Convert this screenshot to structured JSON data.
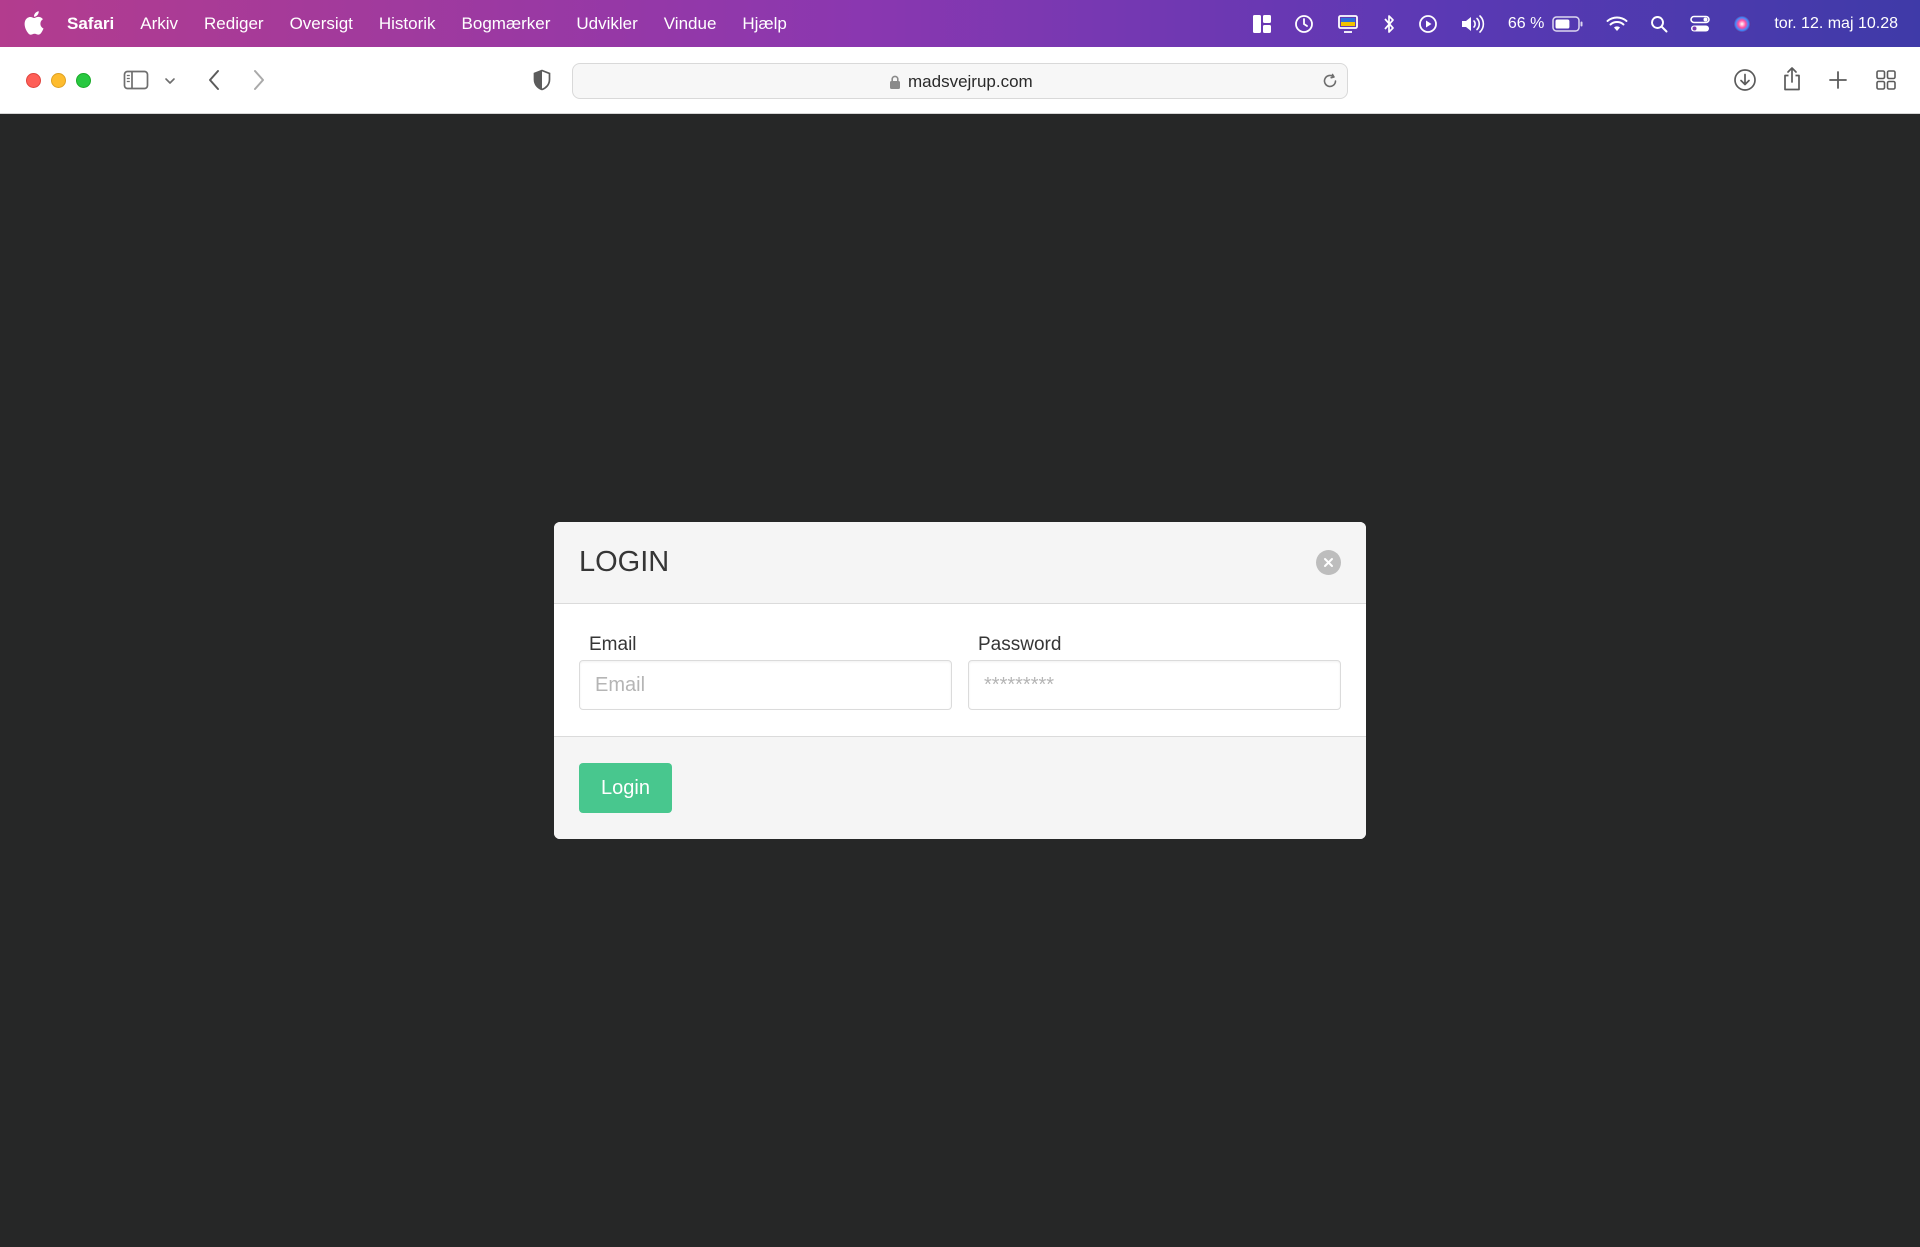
{
  "menubar": {
    "app_name": "Safari",
    "items": [
      "Arkiv",
      "Rediger",
      "Oversigt",
      "Historik",
      "Bogmærker",
      "Udvikler",
      "Vindue",
      "Hjælp"
    ],
    "battery_percent_label": "66 %",
    "battery_level": 0.66,
    "datetime": "tor. 12. maj  10.28",
    "icons": [
      "apple-icon",
      "layout-icon",
      "time-machine-icon",
      "display-icon",
      "bluetooth-icon",
      "play-icon",
      "volume-icon",
      "battery-icon",
      "wifi-icon",
      "spotlight-icon",
      "control-center-icon",
      "siri-icon"
    ]
  },
  "toolbar": {
    "url": "madsvejrup.com",
    "icons": [
      "sidebar-icon",
      "chevron-down-icon",
      "back-icon",
      "forward-icon",
      "privacy-shield-icon",
      "lock-icon",
      "reload-icon",
      "download-icon",
      "share-icon",
      "plus-icon",
      "tab-overview-icon"
    ]
  },
  "login_modal": {
    "title": "LOGIN",
    "email_label": "Email",
    "email_placeholder": "Email",
    "password_label": "Password",
    "password_placeholder": "*********",
    "submit_label": "Login",
    "accent_color": "#48c78e"
  }
}
